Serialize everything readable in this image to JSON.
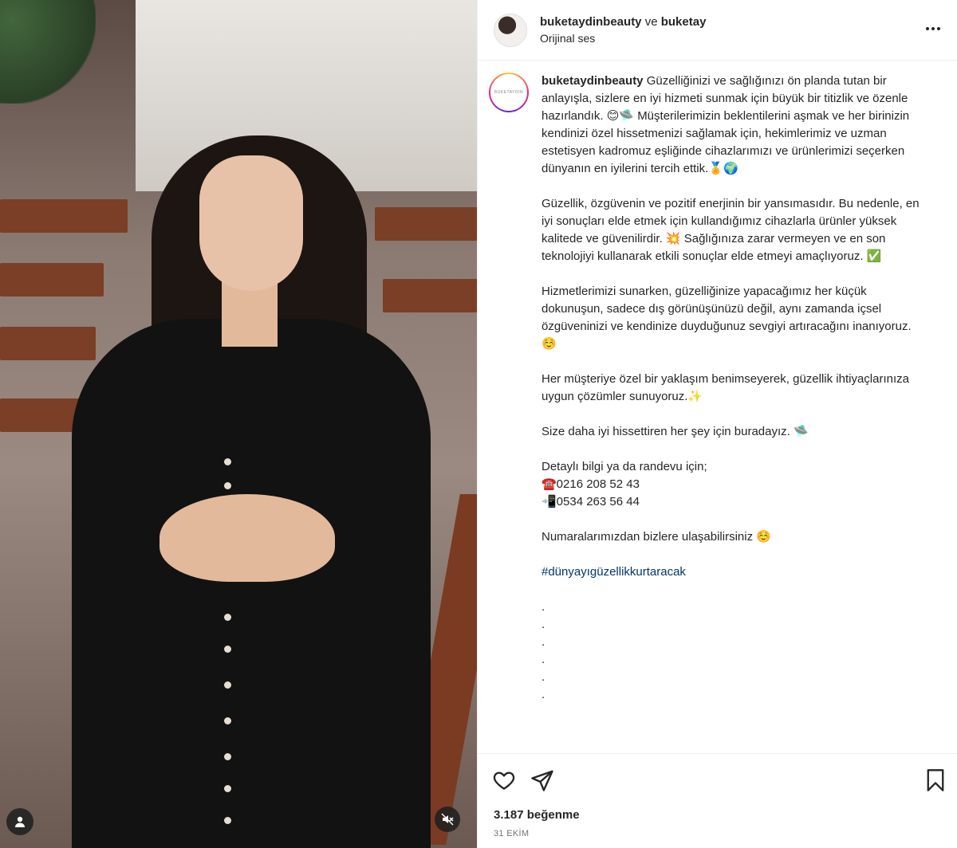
{
  "header": {
    "username": "buketaydinbeauty",
    "conjunction": "ve",
    "collaborator": "buketay",
    "audio": "Orijinal ses",
    "more_icon": "more-horizontal-icon"
  },
  "caption": {
    "username": "buketaydinbeauty",
    "p1": "Güzelliğinizi ve sağlığınızı ön planda tutan bir anlayışla, sizlere en iyi hizmeti sunmak için büyük bir titizlik ve özenle hazırlandık. 😊🛸 Müşterilerimizin beklentilerini aşmak ve her birinizin kendinizi özel hissetmenizi sağlamak için, hekimlerimiz ve uzman estetisyen kadromuz eşliğinde cihazlarımızı ve ürünlerimizi seçerken dünyanın en iyilerini tercih ettik.🏅🌍",
    "p2": "Güzellik, özgüvenin ve pozitif enerjinin bir yansımasıdır. Bu nedenle, en iyi sonuçları elde etmek için kullandığımız cihazlarla ürünler yüksek kalitede ve güvenilirdir. 💥 Sağlığınıza zarar vermeyen ve en son teknolojiyi kullanarak etkili sonuçlar elde etmeyi amaçlıyoruz. ✅",
    "p3": "Hizmetlerimizi sunarken, güzelliğinize yapacağımız her küçük dokunuşun, sadece dış görünüşünüzü değil, aynı zamanda içsel özgüveninizi ve kendinize duyduğunuz sevgiyi artıracağını inanıyoruz. ☺️",
    "p4": "Her müşteriye özel bir yaklaşım benimseyerek, güzellik ihtiyaçlarınıza uygun çözümler sunuyoruz.✨",
    "p5": "Size daha iyi hissettiren her şey için buradayız. 🛸",
    "contact_title": "Detaylı bilgi ya da randevu için;",
    "phone1": "☎️0216 208 52 43",
    "phone2": "📲0534 263 56 44",
    "p7": "Numaralarımızdan bizlere ulaşabilirsiniz ☺️",
    "hashtag": "#dünyayıgüzellikkurtaracak",
    "dots": [
      ".",
      ".",
      ".",
      ".",
      ".",
      "."
    ]
  },
  "actions": {
    "likes": "3.187 beğenme",
    "date": "31 EKİM"
  },
  "colors": {
    "hashtag": "#00376b",
    "text": "#262626",
    "muted": "#737373",
    "divider": "#efefef"
  }
}
